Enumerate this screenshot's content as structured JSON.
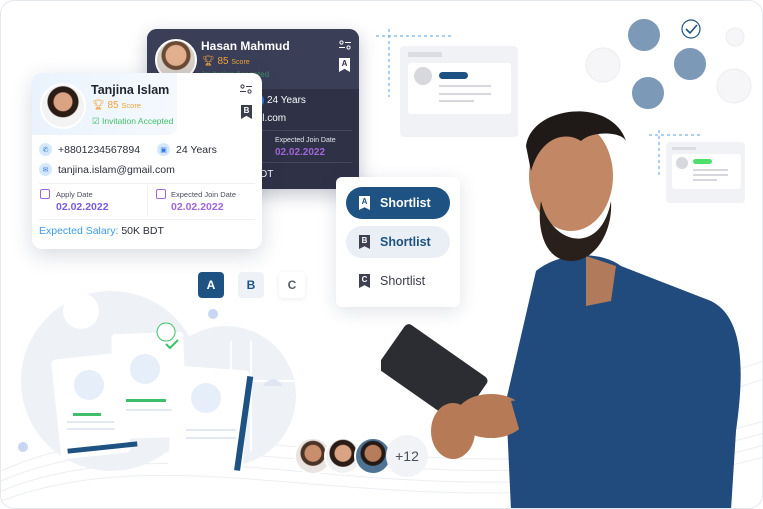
{
  "candidates": {
    "back": {
      "name": "Hasan Mahmud",
      "score": "85",
      "score_label": "Score",
      "status": "Invitation Accepted",
      "age": "24 Years",
      "email_fragment": "il.com",
      "join_date_label": "Expected Join Date",
      "join_date": "02.02.2022",
      "salary_fragment": "DT",
      "bookmark_grade": "A"
    },
    "front": {
      "name": "Tanjina Islam",
      "score": "85",
      "score_label": "Score",
      "status": "Invitation Accepted",
      "phone": "+8801234567894",
      "age": "24 Years",
      "email": "tanjina.islam@gmail.com",
      "apply_date_label": "Apply Date",
      "apply_date": "02.02.2022",
      "join_date_label": "Expected Join Date",
      "join_date": "02.02.2022",
      "salary_label": "Expected Salary:",
      "salary": "50K BDT",
      "bookmark_grade": "B"
    }
  },
  "shortlist_panel": {
    "options": [
      {
        "grade": "A",
        "label": "Shortlist",
        "state": "active"
      },
      {
        "grade": "B",
        "label": "Shortlist",
        "state": "hover"
      },
      {
        "grade": "C",
        "label": "Shortlist",
        "state": "default"
      }
    ]
  },
  "grade_tabs": [
    {
      "label": "A",
      "state": "active"
    },
    {
      "label": "B",
      "state": "secondary"
    },
    {
      "label": "C",
      "state": "default"
    }
  ],
  "applicant_group": {
    "more_count": "+12"
  },
  "colors": {
    "primary": "#1d5283",
    "dark_card": "#2f3146",
    "score": "#f0a33b",
    "accepted": "#3fbf6a",
    "date": "#7a5ae0",
    "join_date": "#a166d8",
    "salary_label": "#3d9ae8"
  }
}
